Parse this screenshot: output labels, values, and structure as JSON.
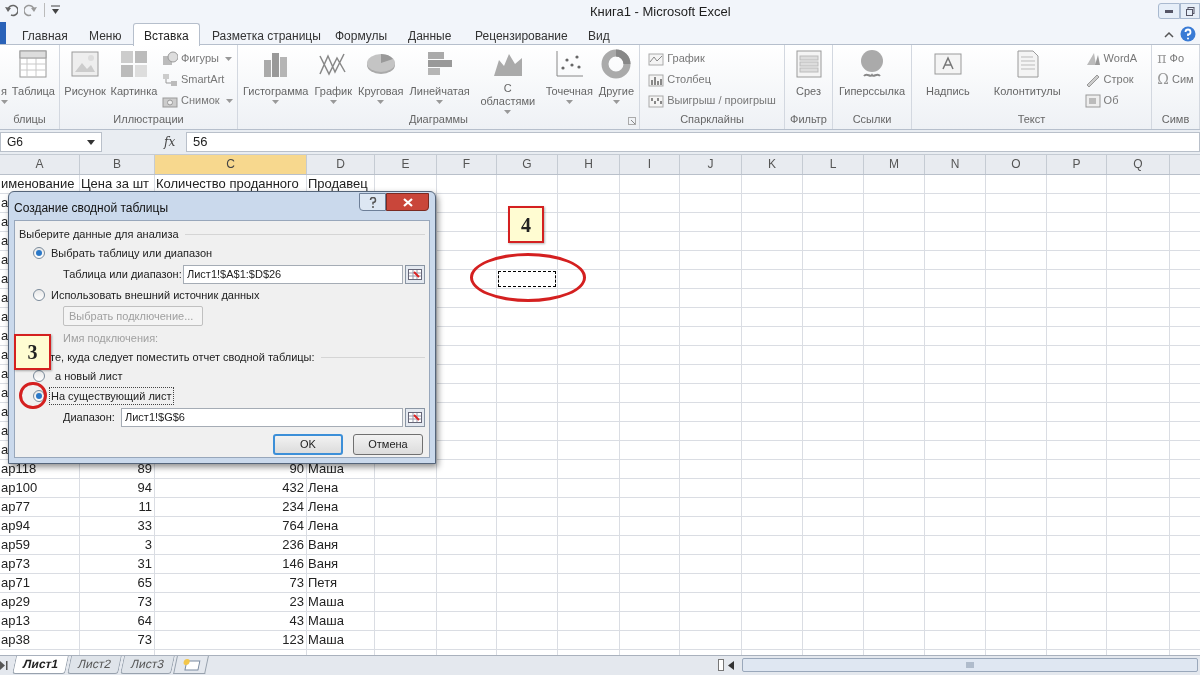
{
  "window": {
    "title": "Книга1 - Microsoft Excel"
  },
  "ribbon_tabs": [
    {
      "label": "Главная",
      "selected": false
    },
    {
      "label": "Меню",
      "selected": false
    },
    {
      "label": "Вставка",
      "selected": true
    },
    {
      "label": "Разметка страницы",
      "selected": false
    },
    {
      "label": "Формулы",
      "selected": false
    },
    {
      "label": "Данные",
      "selected": false
    },
    {
      "label": "Рецензирование",
      "selected": false
    },
    {
      "label": "Вид",
      "selected": false
    }
  ],
  "ribbon_groups": [
    {
      "label": "блицы",
      "launcher": false,
      "items": [
        {
          "kind": "large",
          "label": "я",
          "dropdown": true
        },
        {
          "kind": "large",
          "label": "Таблица",
          "dropdown": false
        }
      ]
    },
    {
      "label": "Иллюстрации",
      "launcher": false,
      "items": [
        {
          "kind": "large",
          "label": "Рисунок",
          "dropdown": false
        },
        {
          "kind": "large",
          "label": "Картинка",
          "dropdown": false
        },
        {
          "kind": "small",
          "label": "Фигуры",
          "dropdown": true
        },
        {
          "kind": "small",
          "label": "SmartArt",
          "dropdown": false
        },
        {
          "kind": "small",
          "label": "Снимок",
          "dropdown": true
        }
      ]
    },
    {
      "label": "Диаграммы",
      "launcher": true,
      "items": [
        {
          "kind": "large",
          "label": "Гистограмма",
          "dropdown": true
        },
        {
          "kind": "large",
          "label": "График",
          "dropdown": true
        },
        {
          "kind": "large",
          "label": "Круговая",
          "dropdown": true
        },
        {
          "kind": "large",
          "label": "Линейчатая",
          "dropdown": true
        },
        {
          "kind": "large",
          "label": "С областями",
          "dropdown": true
        },
        {
          "kind": "large",
          "label": "Точечная",
          "dropdown": true
        },
        {
          "kind": "large",
          "label": "Другие",
          "dropdown": true
        }
      ]
    },
    {
      "label": "Спарклайны",
      "launcher": false,
      "items": [
        {
          "kind": "small",
          "label": "График",
          "dropdown": false
        },
        {
          "kind": "small",
          "label": "Столбец",
          "dropdown": false
        },
        {
          "kind": "small",
          "label": "Выигрыш / проигрыш",
          "dropdown": false
        }
      ]
    },
    {
      "label": "Фильтр",
      "launcher": false,
      "items": [
        {
          "kind": "large",
          "label": "Срез",
          "dropdown": false
        }
      ]
    },
    {
      "label": "Ссылки",
      "launcher": false,
      "items": [
        {
          "kind": "large",
          "label": "Гиперссылка",
          "dropdown": false
        }
      ]
    },
    {
      "label": "Текст",
      "launcher": false,
      "items": [
        {
          "kind": "large",
          "label": "Надпись",
          "dropdown": false
        },
        {
          "kind": "large",
          "label": "Колонтитулы",
          "dropdown": false
        },
        {
          "kind": "small",
          "label": "WordA",
          "dropdown": false
        },
        {
          "kind": "small",
          "label": "Строк",
          "dropdown": false
        },
        {
          "kind": "small",
          "label": "Об",
          "dropdown": false
        }
      ]
    },
    {
      "label": "Симв",
      "launcher": false,
      "items": [
        {
          "kind": "small",
          "label": "Фо",
          "glyph": "π",
          "dropdown": false
        },
        {
          "kind": "small",
          "label": "Сим",
          "glyph": "Ω",
          "dropdown": false
        }
      ]
    }
  ],
  "formula_bar": {
    "name_box": "G6",
    "function_label": "fx",
    "formula": "56"
  },
  "columns": [
    {
      "label": "A",
      "selected": false
    },
    {
      "label": "B",
      "selected": false
    },
    {
      "label": "C",
      "selected": true
    },
    {
      "label": "D",
      "selected": false
    },
    {
      "label": "E",
      "selected": false
    },
    {
      "label": "F",
      "selected": false
    },
    {
      "label": "G",
      "selected": false
    },
    {
      "label": "H",
      "selected": false
    },
    {
      "label": "I",
      "selected": false
    },
    {
      "label": "J",
      "selected": false
    },
    {
      "label": "K",
      "selected": false
    },
    {
      "label": "L",
      "selected": false
    },
    {
      "label": "M",
      "selected": false
    },
    {
      "label": "N",
      "selected": false
    },
    {
      "label": "O",
      "selected": false
    },
    {
      "label": "P",
      "selected": false
    },
    {
      "label": "Q",
      "selected": false
    }
  ],
  "rows": [
    {
      "cells": [
        "именование",
        "Цена за шт",
        "Количество проданного",
        "Продавец"
      ]
    },
    {
      "cells": [
        "а"
      ]
    },
    {
      "cells": [
        "а"
      ]
    },
    {
      "cells": [
        "а"
      ]
    },
    {
      "cells": [
        "а"
      ]
    },
    {
      "cells": [
        "а",
        null,
        null,
        null,
        null,
        null,
        {
          "marquee": true
        }
      ]
    },
    {
      "cells": [
        "а"
      ]
    },
    {
      "cells": [
        "а"
      ]
    },
    {
      "cells": [
        "а"
      ]
    },
    {
      "cells": [
        "а"
      ]
    },
    {
      "cells": [
        "а"
      ]
    },
    {
      "cells": [
        "а"
      ]
    },
    {
      "cells": [
        "а"
      ]
    },
    {
      "cells": [
        "а"
      ]
    },
    {
      "cells": [
        "а"
      ]
    },
    {
      "cells": [
        "ар118",
        "89",
        "90",
        "Маша"
      ]
    },
    {
      "cells": [
        "ар100",
        "94",
        "432",
        "Лена"
      ]
    },
    {
      "cells": [
        "ар77",
        "11",
        "234",
        "Лена"
      ]
    },
    {
      "cells": [
        "ар94",
        "33",
        "764",
        "Лена"
      ]
    },
    {
      "cells": [
        "ар59",
        "3",
        "236",
        "Ваня"
      ]
    },
    {
      "cells": [
        "ар73",
        "31",
        "146",
        "Ваня"
      ]
    },
    {
      "cells": [
        "ар71",
        "65",
        "73",
        "Петя"
      ]
    },
    {
      "cells": [
        "ар29",
        "73",
        "23",
        "Маша"
      ]
    },
    {
      "cells": [
        "ар13",
        "64",
        "43",
        "Маша"
      ]
    },
    {
      "cells": [
        "ар38",
        "73",
        "123",
        "Маша"
      ]
    }
  ],
  "sheet_tabs": [
    {
      "label": "Лист1",
      "selected": true
    },
    {
      "label": "Лист2",
      "selected": false
    },
    {
      "label": "Лист3",
      "selected": false
    }
  ],
  "dialog": {
    "title": "Создание сводной таблицы",
    "source_heading": "Выберите данные для анализа",
    "source_options": [
      {
        "label": "Выбрать таблицу или диапазон",
        "selected": true
      },
      {
        "label": "Использовать внешний источник данных",
        "selected": false
      }
    ],
    "table_range": {
      "label": "Таблица или диапазон:",
      "value": "Лист1!$A$1:$D$26"
    },
    "connection_button": {
      "label": "Выбрать подключение...",
      "disabled": true
    },
    "connection_name": {
      "label": "Имя подключения:",
      "disabled": true
    },
    "destination_heading": "те, куда следует поместить отчет сводной таблицы:",
    "destination_options": [
      {
        "label": "а новый лист",
        "selected": false
      },
      {
        "label": "На существующий лист",
        "selected": true
      }
    ],
    "location": {
      "label": "Диапазон:",
      "value": "Лист1!$G$6"
    },
    "buttons": [
      "OK",
      "Отмена"
    ]
  },
  "callouts": [
    {
      "label": "3"
    },
    {
      "label": "4"
    }
  ]
}
